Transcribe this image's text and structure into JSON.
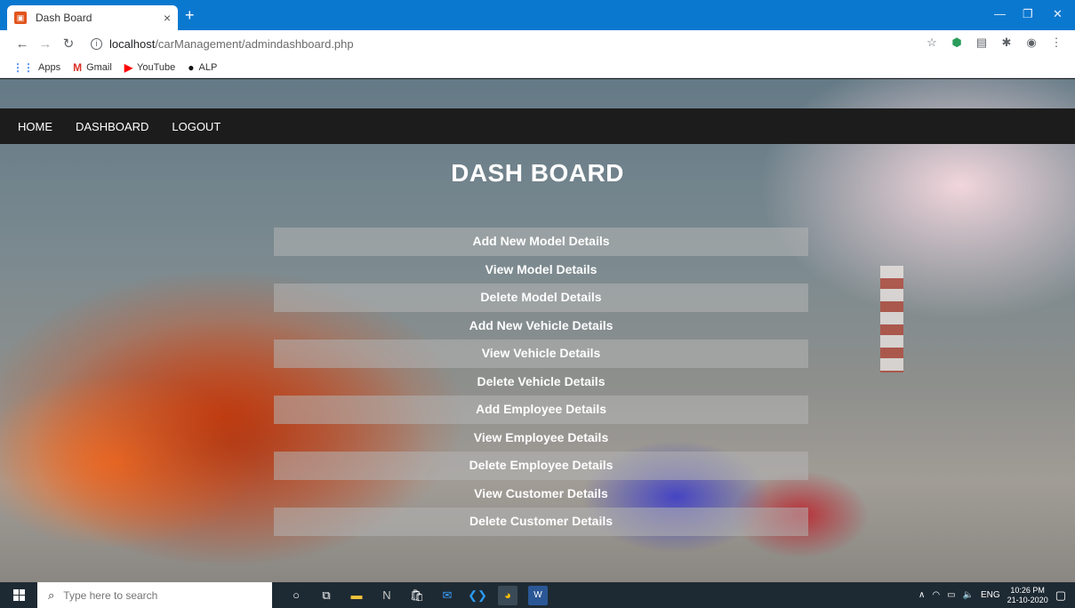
{
  "browser": {
    "tab_title": "Dash Board",
    "tab_close": "×",
    "new_tab": "+",
    "url_host": "localhost",
    "url_path": "/carManagement/admindashboard.php",
    "bookmarks": [
      {
        "icon": "apps-grid-icon",
        "label": "Apps"
      },
      {
        "icon": "gmail-icon",
        "label": "Gmail"
      },
      {
        "icon": "youtube-icon",
        "label": "YouTube"
      },
      {
        "icon": "github-icon",
        "label": "ALP"
      }
    ]
  },
  "nav": {
    "home": "HOME",
    "dashboard": "DASHBOARD",
    "logout": "LOGOUT"
  },
  "page": {
    "title": "DASH BOARD"
  },
  "menu": [
    {
      "label": "Add New Model Details",
      "shaded": true
    },
    {
      "label": "View Model Details",
      "shaded": false
    },
    {
      "label": "Delete Model Details",
      "shaded": true
    },
    {
      "label": "Add New Vehicle Details",
      "shaded": false
    },
    {
      "label": "View Vehicle Details",
      "shaded": true
    },
    {
      "label": "Delete Vehicle Details",
      "shaded": false
    },
    {
      "label": "Add Employee Details",
      "shaded": true
    },
    {
      "label": "View Employee Details",
      "shaded": false
    },
    {
      "label": "Delete Employee Details",
      "shaded": true
    },
    {
      "label": "View Customer Details",
      "shaded": false
    },
    {
      "label": "Delete Customer Details",
      "shaded": true
    }
  ],
  "taskbar": {
    "search_placeholder": "Type here to search",
    "lang": "ENG",
    "time": "10:26 PM",
    "date": "21-10-2020"
  },
  "colors": {
    "tabstrip": "#0b78d0",
    "navbar": "#1c1c1c",
    "menu_shade": "#b4b4b4",
    "taskbar": "#1e2a33"
  }
}
